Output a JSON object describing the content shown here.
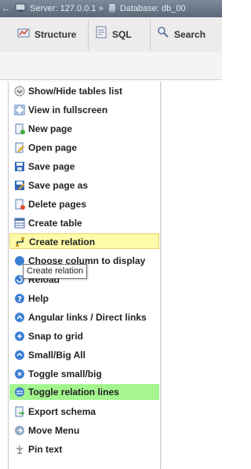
{
  "breadcrumb": {
    "arrow": "←",
    "server_label": "Server: 127.0.0.1 »",
    "database_label": "Database: db_00"
  },
  "tabs": [
    {
      "label": "Structure",
      "icon": "structure-icon"
    },
    {
      "label": "SQL",
      "icon": "sql-icon"
    },
    {
      "label": "Search",
      "icon": "search-icon"
    }
  ],
  "menu": {
    "items": [
      {
        "label": "Show/Hide tables list",
        "icon": "show-hide-icon"
      },
      {
        "label": "View in fullscreen",
        "icon": "fullscreen-icon"
      },
      {
        "label": "New page",
        "icon": "new-page-icon"
      },
      {
        "label": "Open page",
        "icon": "open-page-icon"
      },
      {
        "label": "Save page",
        "icon": "save-icon"
      },
      {
        "label": "Save page as",
        "icon": "save-as-icon"
      },
      {
        "label": "Delete pages",
        "icon": "delete-icon"
      },
      {
        "label": "Create table",
        "icon": "table-icon"
      },
      {
        "label": "Create relation",
        "icon": "relation-icon",
        "state": "hover"
      },
      {
        "label": "Choose column to display",
        "icon": "column-icon"
      },
      {
        "label": "Reload",
        "icon": "reload-icon"
      },
      {
        "label": "Help",
        "icon": "help-icon"
      },
      {
        "label": "Angular links / Direct links",
        "icon": "angular-links-icon"
      },
      {
        "label": "Snap to grid",
        "icon": "snap-icon"
      },
      {
        "label": "Small/Big All",
        "icon": "small-big-icon"
      },
      {
        "label": "Toggle small/big",
        "icon": "toggle-size-icon"
      },
      {
        "label": "Toggle relation lines",
        "icon": "relation-lines-icon",
        "state": "active"
      },
      {
        "label": "Export schema",
        "icon": "export-icon"
      },
      {
        "label": "Move Menu",
        "icon": "move-menu-icon"
      },
      {
        "label": "Pin text",
        "icon": "pin-icon"
      }
    ]
  },
  "tooltip": {
    "text": "Create relation"
  },
  "colors": {
    "hover_bg": "#fffba8",
    "active_bg": "#a3f58e",
    "topbar": "#6b7888"
  }
}
